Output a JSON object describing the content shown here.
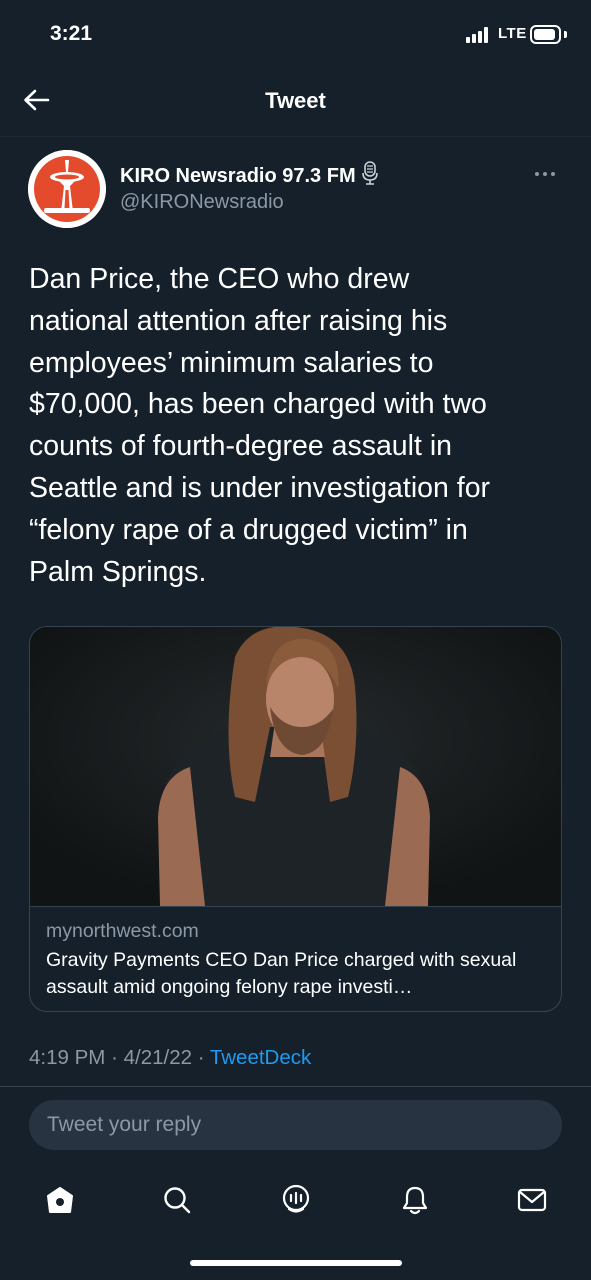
{
  "status_bar": {
    "time": "3:21",
    "network": "LTE",
    "signal_bars": 4,
    "battery_level": 0.78
  },
  "header": {
    "title": "Tweet",
    "back_icon": "arrow-left-icon"
  },
  "author": {
    "name": "KIRO Newsradio 97.3 FM",
    "handle": "@KIRONewsradio",
    "badge_icon": "microphone-icon",
    "more_icon": "more-horizontal-icon"
  },
  "tweet": {
    "text": "Dan Price, the CEO who drew\nnational attention after raising his\nemployees’ minimum salaries to\n$70,000, has been charged with two\ncounts of fourth-degree assault in\nSeattle and is under investigation for\n“felony rape of a drugged victim” in\nPalm Springs."
  },
  "link_card": {
    "domain": "mynorthwest.com",
    "title": "Gravity Payments CEO Dan Price charged with sexual assault amid ongoing felony rape investi…"
  },
  "meta": {
    "time": "4:19 PM",
    "separator": "·",
    "date": "4/21/22",
    "source": "TweetDeck"
  },
  "reply": {
    "placeholder": "Tweet your reply"
  },
  "tab_bar": {
    "items": [
      "home-icon",
      "search-icon",
      "spaces-icon",
      "notifications-icon",
      "messages-icon"
    ]
  },
  "colors": {
    "background": "#15202b",
    "text": "#ffffff",
    "secondary_text": "#8b98a5",
    "accent": "#1d9bf0",
    "border": "#38444d"
  }
}
